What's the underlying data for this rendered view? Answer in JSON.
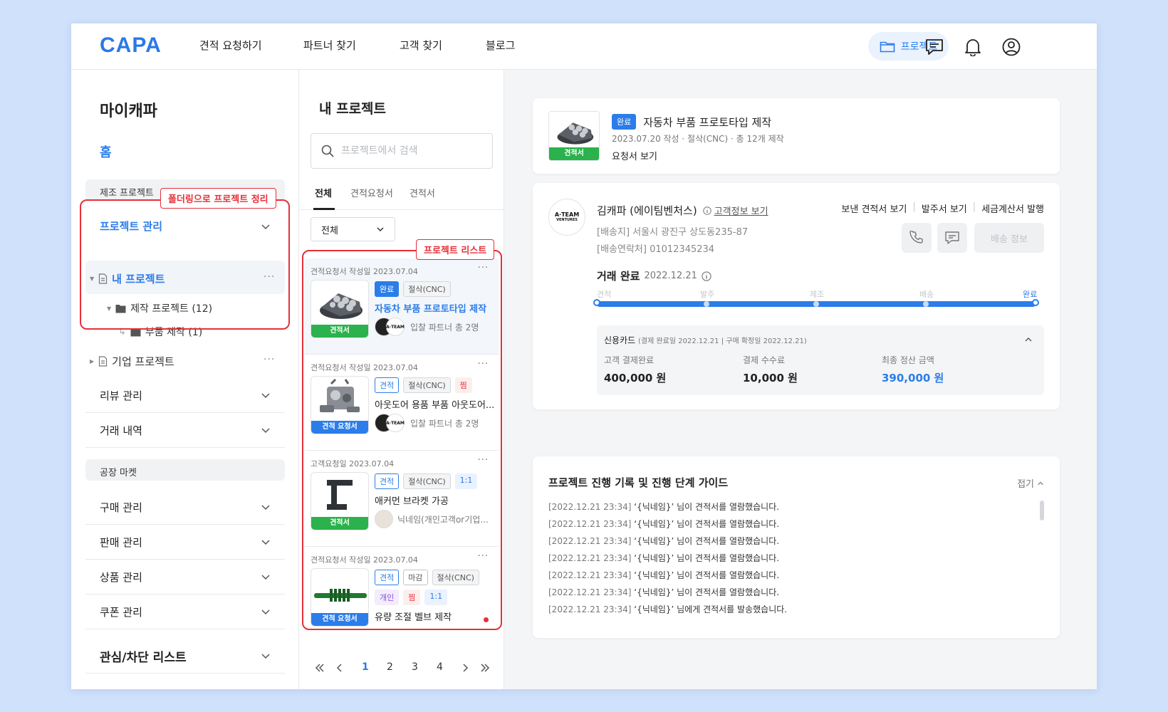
{
  "nav": {
    "logo": "CAPA",
    "links": [
      "견적 요청하기",
      "파트너 찾기",
      "고객 찾기",
      "블로그"
    ],
    "project_button": "프로젝트"
  },
  "sidebar": {
    "title": "마이캐파",
    "home": "홈",
    "group_manufacturing": "제조 프로젝트",
    "project_manage": "프로젝트 관리",
    "my_projects": "내 프로젝트",
    "folder_production": "제작 프로젝트 (12)",
    "folder_parts": "부품 제작 (1)",
    "corporate_projects": "기업 프로젝트",
    "review_manage": "리뷰 관리",
    "transactions": "거래 내역",
    "group_factory": "공장 마켓",
    "purchase_manage": "구매 관리",
    "sales_manage": "판매 관리",
    "product_manage": "상품 관리",
    "coupon_manage": "쿠폰 관리",
    "watch_block": "관심/차단 리스트",
    "annotation_folder": "폴더링으로 프로젝트 정리"
  },
  "middle": {
    "title": "내 프로젝트",
    "search_placeholder": "프로젝트에서 검색",
    "tabs": [
      "전체",
      "견적요청서",
      "견적서"
    ],
    "filter": "전체",
    "annotation_list": "프로젝트 리스트",
    "cards": [
      {
        "date": "견적요청서 작성일 2023.07.04",
        "tag": "견적서",
        "badges": [
          "완료",
          "절삭(CNC)"
        ],
        "title": "자동차 부품 프로토타입 제작",
        "partner": "입찰 파트너 총 2명"
      },
      {
        "date": "견적요청서 작성일 2023.07.04",
        "tag": "견적 요청서",
        "badges": [
          "견적",
          "절삭(CNC)",
          "찜"
        ],
        "title": "아웃도어 용품 부품 아웃도어...",
        "partner": "입찰 파트너 총 2명"
      },
      {
        "date": "고객요청일 2023.07.04",
        "tag": "견적서",
        "badges": [
          "견적",
          "절삭(CNC)",
          "1:1"
        ],
        "title": "애커먼 브라켓 가공",
        "partner": "닉네임(개인고객or기업..."
      },
      {
        "date": "견적요청서 작성일 2023.07.04",
        "tag": "견적 요청서",
        "badges": [
          "견적",
          "마감",
          "절삭(CNC)",
          "개인",
          "찜",
          "1:1"
        ],
        "title": "유량 조절 벨브 제작",
        "partner": ""
      }
    ],
    "pages": [
      "1",
      "2",
      "3",
      "4"
    ],
    "avatar_text": "A·TEAM"
  },
  "detail": {
    "status": "완료",
    "title": "자동차 부품 프로토타입 제작",
    "meta": "2023.07.20 작성 · 절삭(CNC) · 총 12개 제작",
    "view_request": "요청서 보기",
    "thumb_tag": "견적서",
    "customer_logo_1": "A·TEAM",
    "customer_logo_2": "VENTURES",
    "customer_name": "김캐파 (에이팀벤처스)",
    "customer_link": "고객정보 보기",
    "address": "[배송지] 서울시 광진구 상도동235-87",
    "contact": "[배송연락처] 01012345234",
    "actions": [
      "보낸 견적서 보기",
      "발주서 보기",
      "세금계산서 발행"
    ],
    "ship_info": "배송 정보",
    "deal_status": "거래 완료",
    "deal_date": "2022.12.21",
    "stages": [
      "견적",
      "발주",
      "제조",
      "배송",
      "완료"
    ],
    "progress": 1.0,
    "payment": {
      "method": "신용카드",
      "sub": "(결제 완료일 2022.12.21 | 구매 확정일 2022.12.21)",
      "cols": [
        {
          "label": "고객 결제완료",
          "value": "400,000 원"
        },
        {
          "label": "결제 수수료",
          "value": "10,000 원"
        },
        {
          "label": "최종 정산 금액",
          "value": "390,000 원"
        }
      ]
    },
    "log_title": "프로젝트 진행 기록 및 진행 단계 가이드",
    "log_fold": "접기",
    "logs": [
      {
        "ts": "[2022.12.21 23:34]",
        "msg": "‘{닉네임}’ 님이 견적서를 열람했습니다."
      },
      {
        "ts": "[2022.12.21 23:34]",
        "msg": "‘{닉네임}’ 님이 견적서를 열람했습니다."
      },
      {
        "ts": "[2022.12.21 23:34]",
        "msg": "‘{닉네임}’ 님이 견적서를 열람했습니다."
      },
      {
        "ts": "[2022.12.21 23:34]",
        "msg": "‘{닉네임}’ 님이 견적서를 열람했습니다."
      },
      {
        "ts": "[2022.12.21 23:34]",
        "msg": "‘{닉네임}’ 님이 견적서를 열람했습니다."
      },
      {
        "ts": "[2022.12.21 23:34]",
        "msg": "‘{닉네임}’ 님이 견적서를 열람했습니다."
      },
      {
        "ts": "[2022.12.21 23:34]",
        "msg": "‘{닉네임}’ 님에게 견적서를 발송했습니다."
      }
    ]
  },
  "colors": {
    "accent": "#2b7de9",
    "success": "#2bb24c",
    "annotation": "#e5303a"
  }
}
